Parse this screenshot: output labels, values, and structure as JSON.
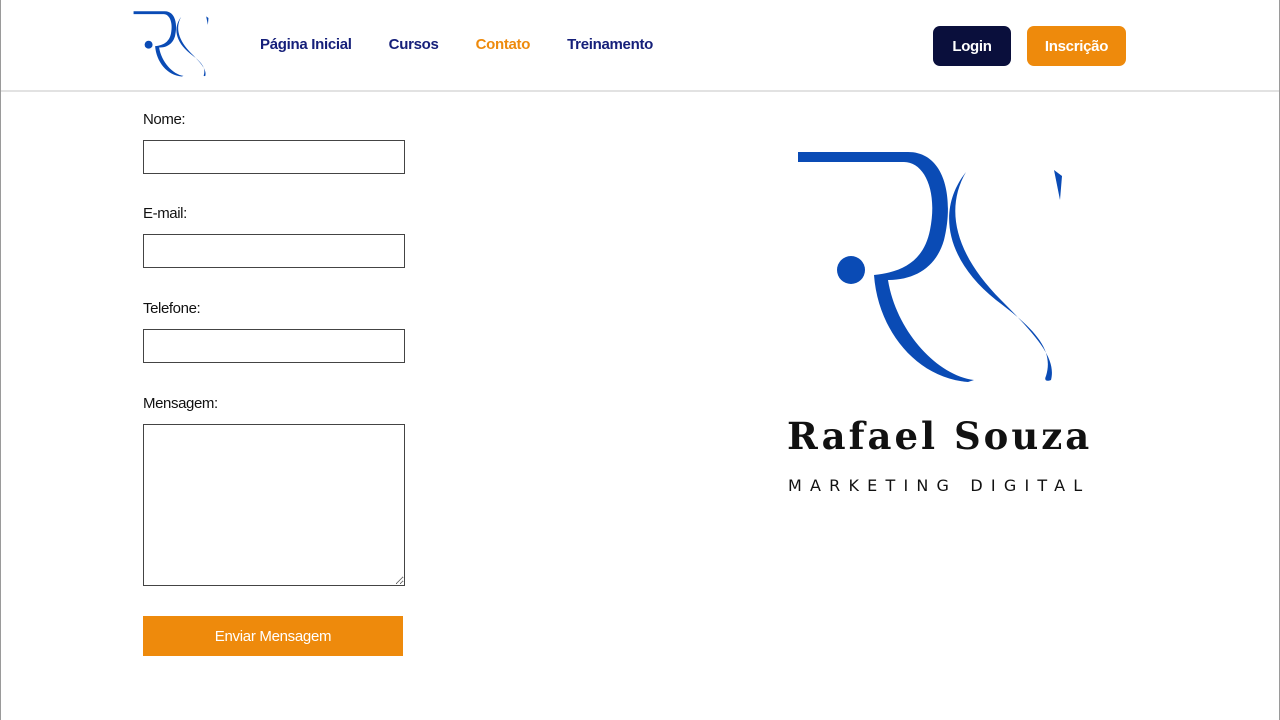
{
  "colors": {
    "brand_blue": "#0a4bb5",
    "nav_text": "#16207a",
    "accent_orange": "#ee8a0c",
    "login_bg": "#0a0f3c"
  },
  "header": {
    "logo_icon": "rs-monogram-icon",
    "nav": [
      {
        "label": "Página Inicial",
        "active": false
      },
      {
        "label": "Cursos",
        "active": false
      },
      {
        "label": "Contato",
        "active": true
      },
      {
        "label": "Treinamento",
        "active": false
      }
    ],
    "login_label": "Login",
    "signup_label": "Inscrição"
  },
  "form": {
    "name_label": "Nome:",
    "name_value": "",
    "email_label": "E-mail:",
    "email_value": "",
    "phone_label": "Telefone:",
    "phone_value": "",
    "message_label": "Mensagem:",
    "message_value": "",
    "submit_label": "Enviar Mensagem"
  },
  "brand": {
    "logo_icon": "rs-monogram-icon",
    "name": "Rafael Souza",
    "tagline": "MARKETING DIGITAL"
  }
}
